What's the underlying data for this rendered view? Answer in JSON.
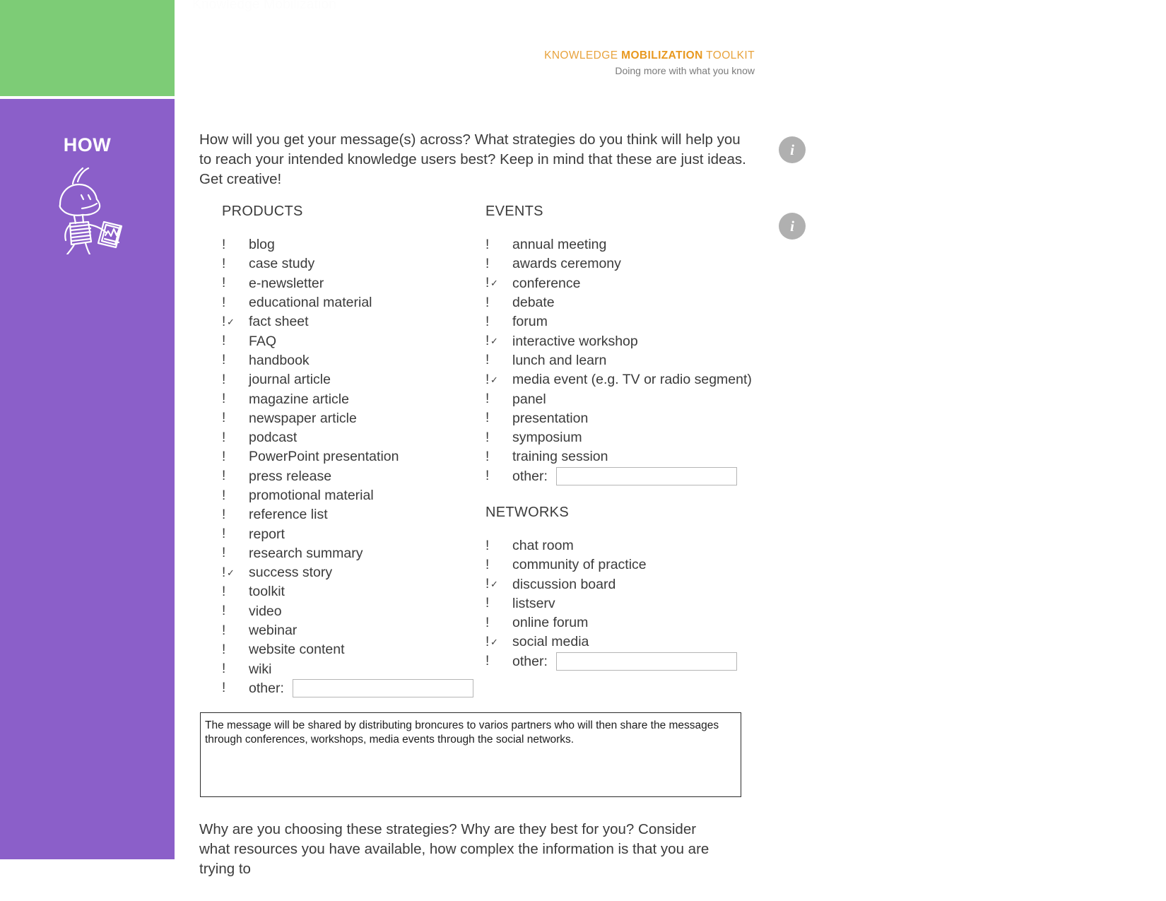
{
  "ghost_header": "Knowledge Mobilization",
  "brand": {
    "line1_a": "KNOWLEDGE ",
    "line1_b": "MOBILIZATION",
    "line1_c": " TOOLKIT",
    "tagline": "Doing more with what you know"
  },
  "sidebar": {
    "title": "HOW",
    "illustration": "stick-figure-reading-tablet"
  },
  "colors": {
    "green": "#7dcc76",
    "purple": "#8b5fc9",
    "brand_orange": "#e8a33d",
    "info_gray": "#b0b0b0"
  },
  "intro_paragraph": "How will you get your message(s) across? What strategies do you think will help you to reach your intended knowledge users best? Keep in mind that these are just ideas. Get creative!",
  "info_badges": [
    {
      "label": "i",
      "name": "info-icon-strategies"
    },
    {
      "label": "i",
      "name": "info-icon-options"
    }
  ],
  "groups": [
    {
      "heading": "PRODUCTS",
      "items": [
        {
          "label": "blog",
          "checked": false
        },
        {
          "label": "case study",
          "checked": false
        },
        {
          "label": "e-newsletter",
          "checked": false
        },
        {
          "label": "educational material",
          "checked": false
        },
        {
          "label": "fact sheet",
          "checked": true
        },
        {
          "label": "FAQ",
          "checked": false
        },
        {
          "label": "handbook",
          "checked": false
        },
        {
          "label": "journal article",
          "checked": false
        },
        {
          "label": "magazine article",
          "checked": false
        },
        {
          "label": "newspaper article",
          "checked": false
        },
        {
          "label": "podcast",
          "checked": false
        },
        {
          "label": "PowerPoint presentation",
          "checked": false
        },
        {
          "label": "press release",
          "checked": false
        },
        {
          "label": "promotional material",
          "checked": false
        },
        {
          "label": "reference list",
          "checked": false
        },
        {
          "label": "report",
          "checked": false
        },
        {
          "label": "research summary",
          "checked": false
        },
        {
          "label": "success story",
          "checked": true
        },
        {
          "label": "toolkit",
          "checked": false
        },
        {
          "label": "video",
          "checked": false
        },
        {
          "label": "webinar",
          "checked": false
        },
        {
          "label": "website content",
          "checked": false
        },
        {
          "label": "wiki",
          "checked": false
        }
      ],
      "other_label": "other:",
      "other_value": ""
    },
    {
      "heading": "EVENTS",
      "items": [
        {
          "label": "annual meeting",
          "checked": false
        },
        {
          "label": "awards ceremony",
          "checked": false
        },
        {
          "label": "conference",
          "checked": true
        },
        {
          "label": "debate",
          "checked": false
        },
        {
          "label": "forum",
          "checked": false
        },
        {
          "label": "interactive workshop",
          "checked": true
        },
        {
          "label": "lunch and learn",
          "checked": false
        },
        {
          "label": "media event (e.g. TV or radio segment)",
          "checked": true
        },
        {
          "label": "panel",
          "checked": false
        },
        {
          "label": "presentation",
          "checked": false
        },
        {
          "label": "symposium",
          "checked": false
        },
        {
          "label": "training session",
          "checked": false
        }
      ],
      "other_label": "other:",
      "other_value": ""
    },
    {
      "heading": "NETWORKS",
      "items": [
        {
          "label": "chat room",
          "checked": false
        },
        {
          "label": "community of practice",
          "checked": false
        },
        {
          "label": "discussion board",
          "checked": true
        },
        {
          "label": "listserv",
          "checked": false
        },
        {
          "label": "online forum",
          "checked": false
        },
        {
          "label": "social media",
          "checked": true
        }
      ],
      "other_label": "other:",
      "other_value": ""
    }
  ],
  "answer_box": {
    "text": "The message will be shared by distributing broncures to varios partners who will then share the messages through conferences, workshops, media events through the social networks."
  },
  "outro_paragraph": "Why are you choosing these strategies? Why are they best for you? Consider what resources you have available, how complex the information is that you are trying to"
}
